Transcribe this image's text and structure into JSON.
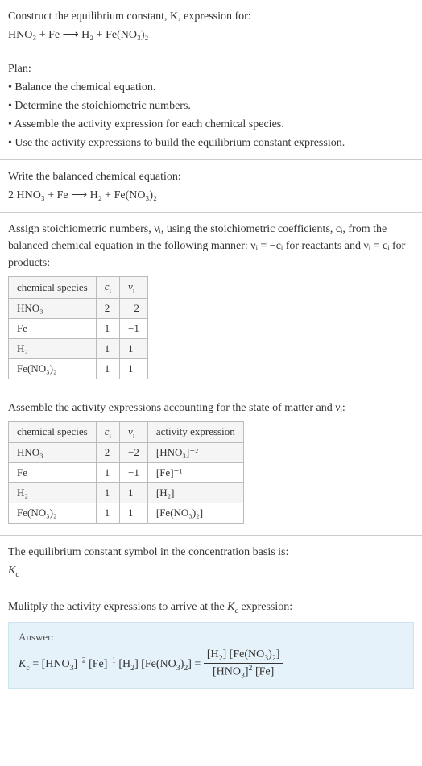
{
  "q": {
    "line1": "Construct the equilibrium constant, K, expression for:",
    "eq": "HNO₃ + Fe ⟶ H₂ + Fe(NO₃)₂"
  },
  "plan": {
    "title": "Plan:",
    "items": [
      "• Balance the chemical equation.",
      "• Determine the stoichiometric numbers.",
      "• Assemble the activity expression for each chemical species.",
      "• Use the activity expressions to build the equilibrium constant expression."
    ]
  },
  "balanced": {
    "text": "Write the balanced chemical equation:",
    "eq": "2 HNO₃ + Fe ⟶ H₂ + Fe(NO₃)₂"
  },
  "stoich": {
    "text": "Assign stoichiometric numbers, νᵢ, using the stoichiometric coefficients, cᵢ, from the balanced chemical equation in the following manner: νᵢ = −cᵢ for reactants and νᵢ = cᵢ for products:",
    "headers": [
      "chemical species",
      "cᵢ",
      "νᵢ"
    ],
    "rows": [
      [
        "HNO₃",
        "2",
        "−2"
      ],
      [
        "Fe",
        "1",
        "−1"
      ],
      [
        "H₂",
        "1",
        "1"
      ],
      [
        "Fe(NO₃)₂",
        "1",
        "1"
      ]
    ]
  },
  "activity": {
    "text": "Assemble the activity expressions accounting for the state of matter and νᵢ:",
    "headers": [
      "chemical species",
      "cᵢ",
      "νᵢ",
      "activity expression"
    ],
    "rows": [
      [
        "HNO₃",
        "2",
        "−2",
        "[HNO₃]⁻²"
      ],
      [
        "Fe",
        "1",
        "−1",
        "[Fe]⁻¹"
      ],
      [
        "H₂",
        "1",
        "1",
        "[H₂]"
      ],
      [
        "Fe(NO₃)₂",
        "1",
        "1",
        "[Fe(NO₃)₂]"
      ]
    ]
  },
  "symbol": {
    "text": "The equilibrium constant symbol in the concentration basis is:",
    "val": "K_c"
  },
  "mult": {
    "text": "Mulitply the activity expressions to arrive at the K_c expression:"
  },
  "answer": {
    "label": "Answer:",
    "lhs": "K_c = [HNO₃]⁻² [Fe]⁻¹ [H₂] [Fe(NO₃)₂] =",
    "frac_num": "[H₂] [Fe(NO₃)₂]",
    "frac_den": "[HNO₃]² [Fe]"
  },
  "chart_data": {
    "type": "table",
    "tables": [
      {
        "title": "Stoichiometric numbers",
        "columns": [
          "chemical species",
          "c_i",
          "ν_i"
        ],
        "rows": [
          {
            "chemical species": "HNO3",
            "c_i": 2,
            "ν_i": -2
          },
          {
            "chemical species": "Fe",
            "c_i": 1,
            "ν_i": -1
          },
          {
            "chemical species": "H2",
            "c_i": 1,
            "ν_i": 1
          },
          {
            "chemical species": "Fe(NO3)2",
            "c_i": 1,
            "ν_i": 1
          }
        ]
      },
      {
        "title": "Activity expressions",
        "columns": [
          "chemical species",
          "c_i",
          "ν_i",
          "activity expression"
        ],
        "rows": [
          {
            "chemical species": "HNO3",
            "c_i": 2,
            "ν_i": -2,
            "activity expression": "[HNO3]^-2"
          },
          {
            "chemical species": "Fe",
            "c_i": 1,
            "ν_i": -1,
            "activity expression": "[Fe]^-1"
          },
          {
            "chemical species": "H2",
            "c_i": 1,
            "ν_i": 1,
            "activity expression": "[H2]"
          },
          {
            "chemical species": "Fe(NO3)2",
            "c_i": 1,
            "ν_i": 1,
            "activity expression": "[Fe(NO3)2]"
          }
        ]
      }
    ]
  }
}
